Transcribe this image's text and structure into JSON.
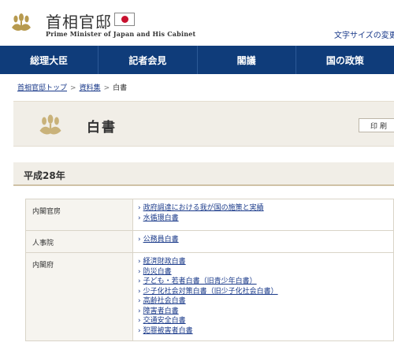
{
  "header": {
    "title": "首相官邸",
    "subtitle": "Prime Minister of Japan and His Cabinet",
    "font_size_link": "文字サイズの変更"
  },
  "nav": {
    "items": [
      {
        "label": "総理大臣"
      },
      {
        "label": "記者会見"
      },
      {
        "label": "閣議"
      },
      {
        "label": "国の政策"
      }
    ]
  },
  "breadcrumb": {
    "home": "首相官邸トップ",
    "parent": "資料集",
    "current": "白書",
    "separator": ">"
  },
  "page": {
    "title": "白書",
    "print_label": "印刷"
  },
  "section": {
    "heading": "平成28年"
  },
  "table": {
    "rows": [
      {
        "agency": "内閣官房",
        "links": [
          "政府調達における我が国の施策と実績",
          "水循環白書"
        ]
      },
      {
        "agency": "人事院",
        "links": [
          "公務員白書"
        ]
      },
      {
        "agency": "内閣府",
        "links": [
          "経済財政白書",
          "防災白書",
          "子ども・若者白書（旧青少年白書）",
          "少子化社会対策白書（旧少子化社会白書）",
          "高齢社会白書",
          "障害者白書",
          "交通安全白書",
          "犯罪被害者白書"
        ]
      }
    ]
  },
  "colors": {
    "nav_bg": "#0f3c7a",
    "link": "#1a3a8a",
    "panel_bg": "#f1eee7",
    "emblem_gold": "#b79a4f",
    "flag_red": "#c8102e"
  },
  "icons": {
    "emblem": "paulownia-crest-icon",
    "flag": "japan-flag-icon",
    "bullet": "chevron-right-icon"
  }
}
